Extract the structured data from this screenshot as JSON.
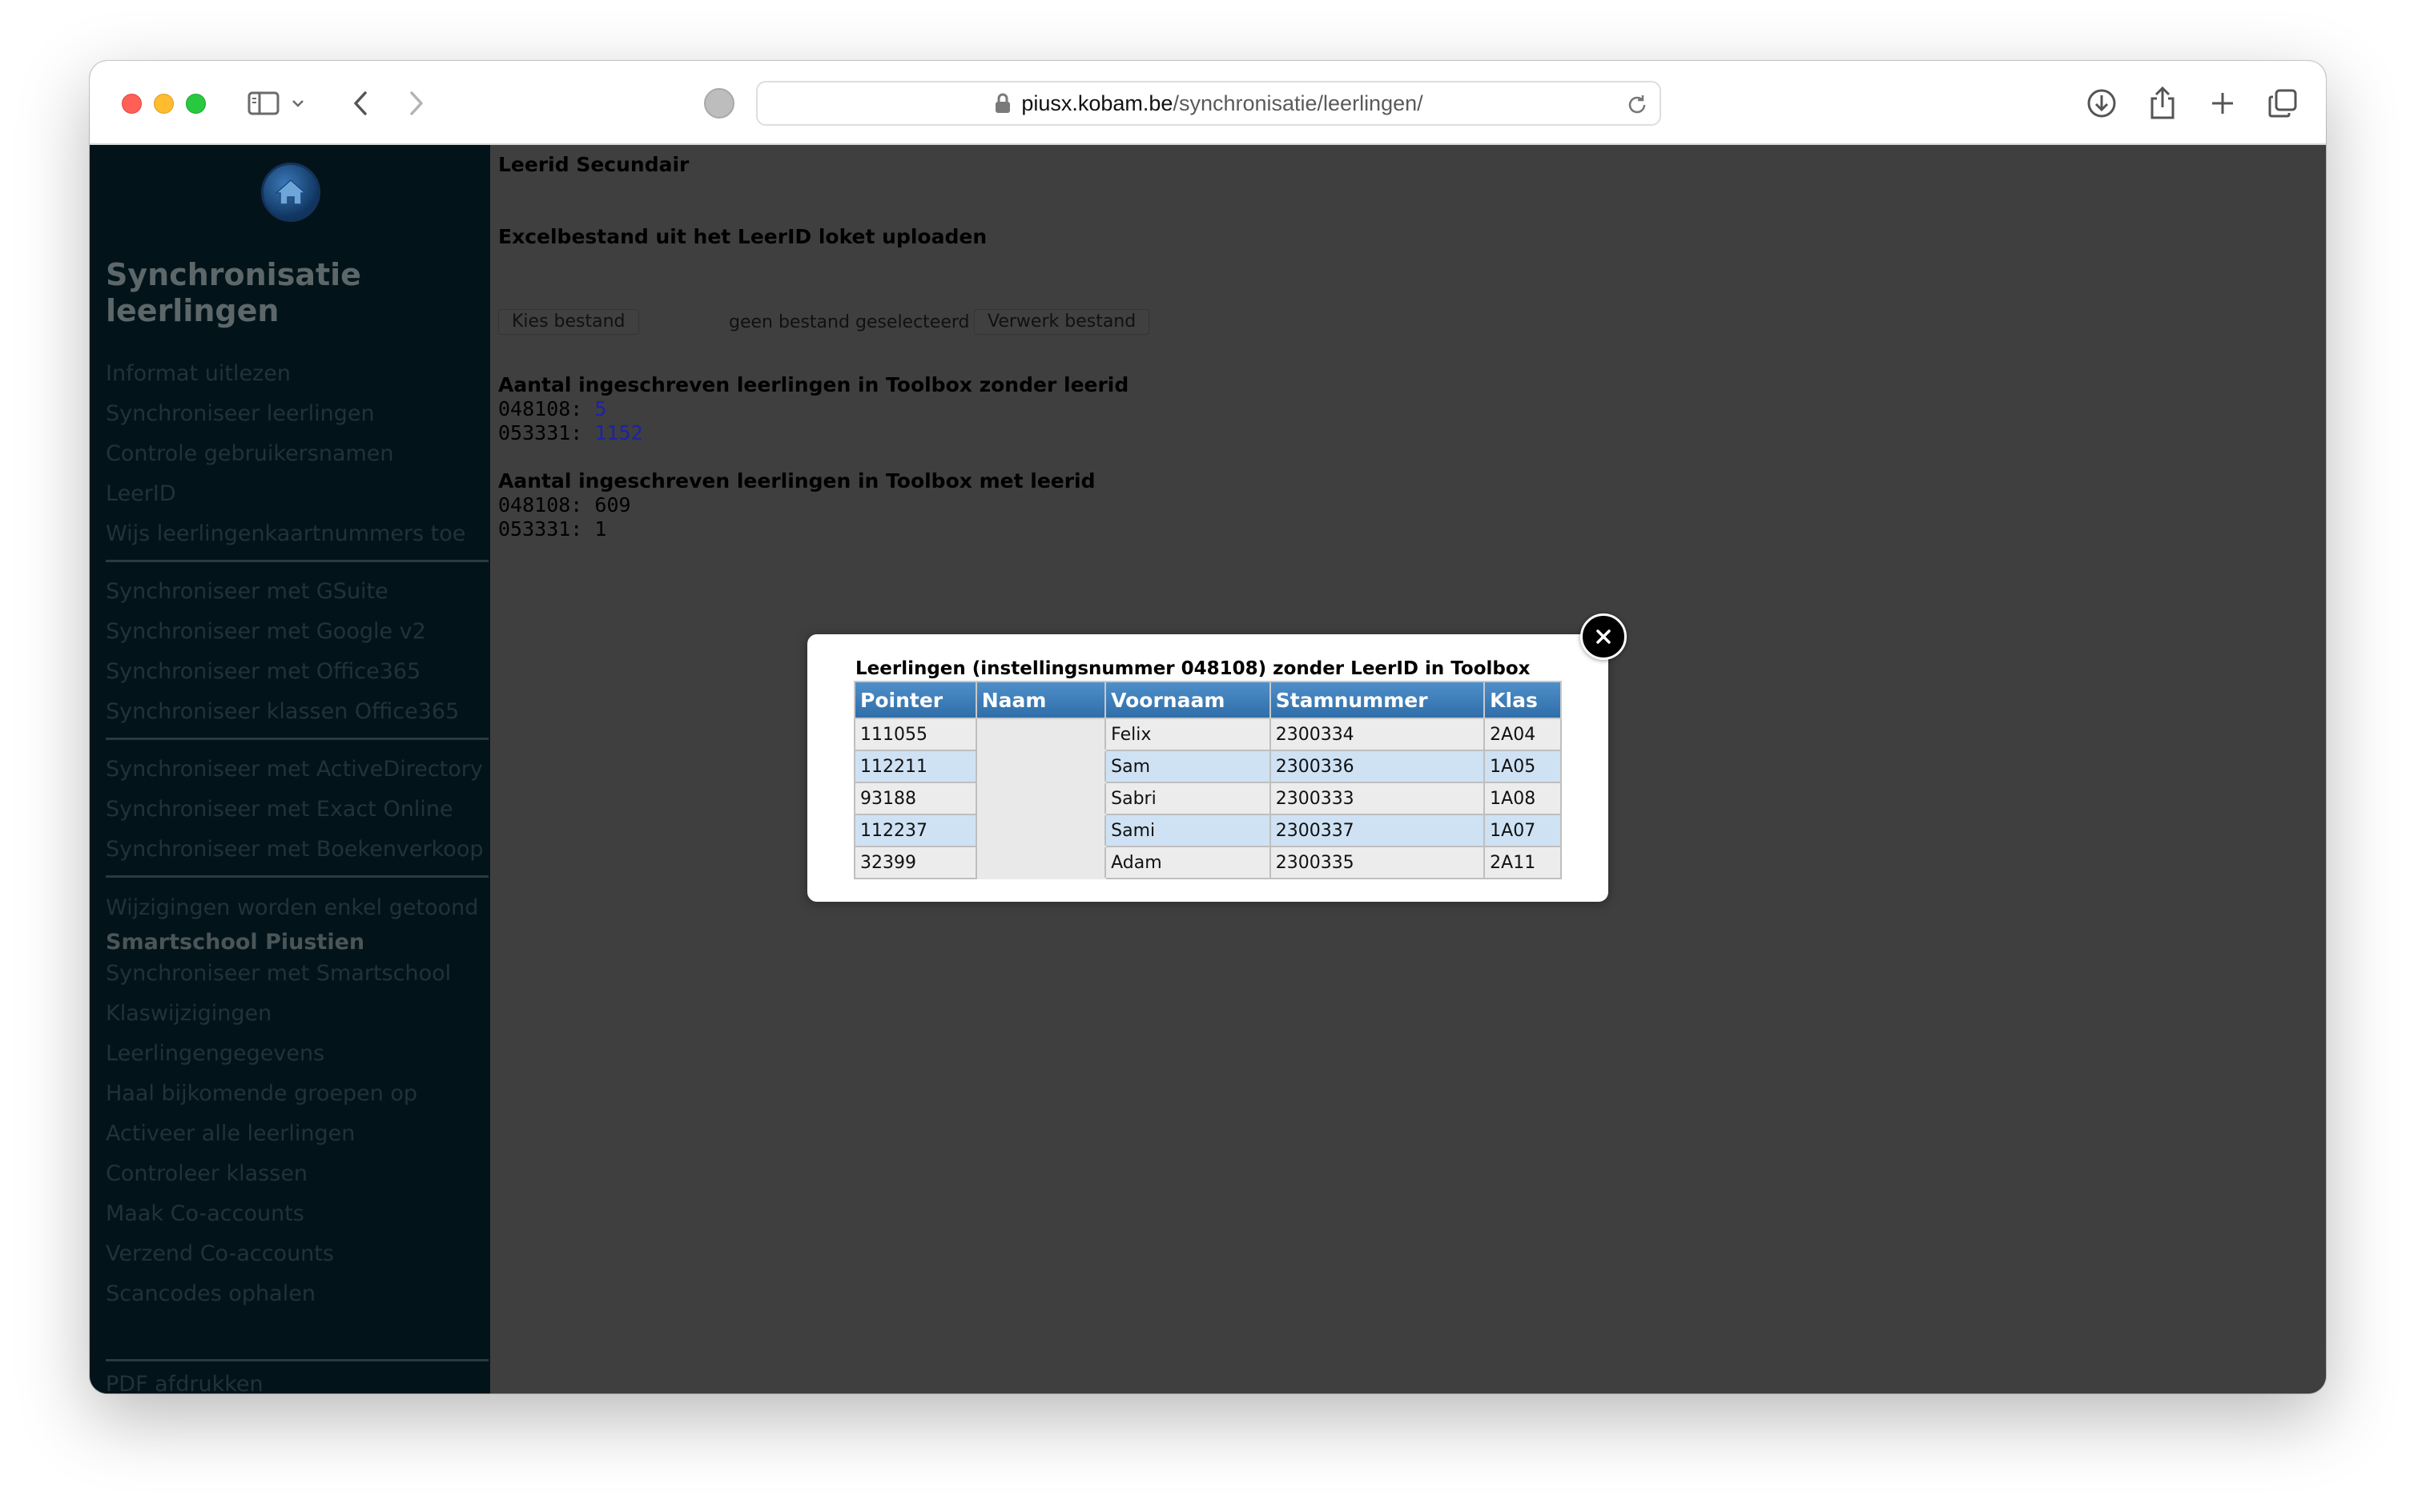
{
  "browser": {
    "url_host": "piusx.kobam.be",
    "url_path": "/synchronisatie/leerlingen/"
  },
  "sidebar": {
    "title": "Synchronisatie leerlingen",
    "items": [
      "Informat uitlezen",
      "Synchroniseer leerlingen",
      "Controle gebruikersnamen",
      "LeerID",
      "Wijs leerlingenkaartnummers toe",
      "Synchroniseer met GSuite",
      "Synchroniseer met Google v2",
      "Synchroniseer met Office365",
      "Synchroniseer klassen Office365",
      "Synchroniseer met ActiveDirectory",
      "Synchroniseer met Exact Online",
      "Synchroniseer met Boekenverkoop",
      "Wijzigingen worden enkel getoond",
      "Smartschool Piustien",
      "Synchroniseer met Smartschool",
      "Klaswijzigingen",
      "Leerlingengegevens",
      "Haal bijkomende groepen op",
      "Activeer alle leerlingen",
      "Controleer klassen",
      "Maak Co-accounts",
      "Verzend Co-accounts",
      "Scancodes ophalen",
      "PDF afdrukken"
    ]
  },
  "main": {
    "heading": "Leerid Secundair",
    "upload_heading": "Excelbestand uit het LeerID loket uploaden",
    "choose_file_label": "Kies bestand",
    "no_file_label": "geen bestand geselecteerd",
    "process_label": "Verwerk bestand",
    "without_heading": "Aantal ingeschreven leerlingen in Toolbox zonder leerid",
    "without_rows": [
      {
        "code": "048108:",
        "count": "5"
      },
      {
        "code": "053331:",
        "count": "1152"
      }
    ],
    "with_heading": "Aantal ingeschreven leerlingen in Toolbox met leerid",
    "with_rows": [
      {
        "code": "048108:",
        "count": "609"
      },
      {
        "code": "053331:",
        "count": "1"
      }
    ]
  },
  "modal": {
    "title": "Leerlingen (instellingsnummer 048108) zonder LeerID in Toolbox",
    "columns": [
      "Pointer",
      "Naam",
      "Voornaam",
      "Stamnummer",
      "Klas"
    ],
    "rows": [
      [
        "111055",
        "",
        "Felix",
        "2300334",
        "2A04"
      ],
      [
        "112211",
        "",
        "Sam",
        "2300336",
        "1A05"
      ],
      [
        "93188",
        "",
        "Sabri",
        "2300333",
        "1A08"
      ],
      [
        "112237",
        "",
        "Sami",
        "2300337",
        "1A07"
      ],
      [
        "32399",
        "",
        "Adam",
        "2300335",
        "2A11"
      ]
    ]
  }
}
